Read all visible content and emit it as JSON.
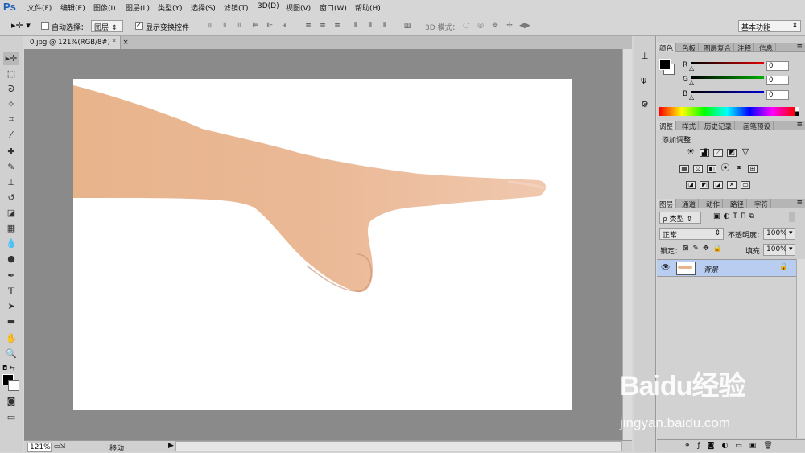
{
  "app": {
    "logo": "Ps",
    "accent": "#1a5eb8"
  },
  "menu": [
    "文件(F)",
    "编辑(E)",
    "图像(I)",
    "图层(L)",
    "类型(Y)",
    "选择(S)",
    "滤镜(T)",
    "3D(D)",
    "视图(V)",
    "窗口(W)",
    "帮助(H)"
  ],
  "options": {
    "auto_select_label": "自动选择：",
    "auto_select_value": "图层",
    "show_transform_label": "显示变换控件",
    "mode_3d_label": "3D 模式：",
    "workspace": "基本功能"
  },
  "document": {
    "tab_title": "0.jpg @ 121%(RGB/8#) *",
    "close": "×"
  },
  "status": {
    "zoom": "121%",
    "tool": "移动"
  },
  "color_panel": {
    "tabs": [
      "颜色",
      "色板",
      "图层复合",
      "注释",
      "信息"
    ],
    "r_label": "R",
    "g_label": "G",
    "b_label": "B",
    "r": "0",
    "g": "0",
    "b": "0",
    "colors": {
      "r": "#e00000",
      "g": "#00b000",
      "b": "#0000d0"
    }
  },
  "adjust_panel": {
    "tabs": [
      "调整",
      "样式",
      "历史记录",
      "画笔预设"
    ],
    "heading": "添加调整"
  },
  "layers_panel": {
    "tabs": [
      "图层",
      "通道",
      "动作",
      "路径",
      "字符"
    ],
    "filter": "ρ 类型",
    "blend_mode": "正常",
    "opacity_label": "不透明度：",
    "opacity": "100%",
    "lock_label": "锁定：",
    "fill_label": "填充：",
    "fill": "100%",
    "layer_name": "背景",
    "highlight": "#b9cdf0"
  },
  "watermark": {
    "brand": "Baidu经验",
    "url": "jingyan.baidu.com"
  }
}
